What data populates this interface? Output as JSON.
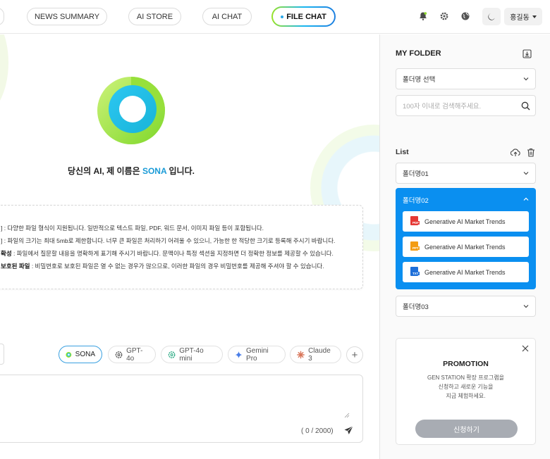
{
  "nav": {
    "tabs": [
      {
        "label": "NEWS SUMMARY"
      },
      {
        "label": "AI STORE"
      },
      {
        "label": "AI CHAT"
      },
      {
        "label": "FILE CHAT"
      }
    ],
    "active_tab": "FILE CHAT",
    "user_label": "홍길동"
  },
  "main": {
    "greeting_prefix": "당신의 AI, 제 이름은 ",
    "assistant_name": "SONA",
    "greeting_suffix": " 입니다.",
    "info_lines": [
      {
        "title": "",
        "text": "] : 다양한 파일 형식이 지원됩니다. 일반적으로 텍스트 파일, PDF, 워드 문서, 이미지 파일 등이 포함됩니다."
      },
      {
        "title": "",
        "text": "] : 파일의 크기는 최대 5mb로 제한합니다. 너무 큰 파일은 처리하기 어려울 수 있으니, 가능한 한 적당한 크기로 등록해 주시기 바랍니다."
      },
      {
        "title": "확성",
        "text": " : 파일에서 질문할 내용을 명확하게 표기해 주시기 바랍니다. 문맥이나 특정 섹션을 지정하면 더 정확한 정보를 제공할 수 있습니다."
      },
      {
        "title": "보호된 파일",
        "text": " : 비밀번호로 보호된 파일은 열 수 없는 경우가 많으므로, 이러한 파일의 경우 비밀번호를 제공해 주셔야 할 수 있습니다."
      }
    ],
    "models": [
      {
        "label": "SONA",
        "active": true
      },
      {
        "label": "GPT-4o",
        "active": false
      },
      {
        "label": "GPT-4o mini",
        "active": false
      },
      {
        "label": "Gemini Pro",
        "active": false
      },
      {
        "label": "Claude 3",
        "active": false
      }
    ],
    "chat_input_value": "",
    "counter": "( 0 / 2000)"
  },
  "panel": {
    "title": "MY FOLDER",
    "folder_select": "폴더명 선택",
    "search_placeholder": "100자 이내로 검색해주세요.",
    "list_title": "List",
    "folders": [
      {
        "name": "폴더명01",
        "expanded": false
      },
      {
        "name": "폴더명02",
        "expanded": true,
        "files": [
          {
            "type": "PDF",
            "name": "Generative AI Market Trends"
          },
          {
            "type": "PPT",
            "name": "Generative AI Market Trends"
          },
          {
            "type": "TXT",
            "name": "Generative AI Market Trends"
          }
        ]
      },
      {
        "name": "폴더명03",
        "expanded": false
      }
    ],
    "promo": {
      "title": "PROMOTION",
      "lines": [
        "GEN STATION 확장 프로그램을",
        "신청하고 새로운 기능을",
        "지금 체험하세요."
      ],
      "button": "신청하기"
    }
  },
  "colors": {
    "accent_blue": "#0a8ff0",
    "sona_blue": "#1a9bd7",
    "green": "#8ed92b",
    "pdf": "#e53935",
    "ppt": "#f39c12",
    "txt": "#1e6fd9"
  }
}
